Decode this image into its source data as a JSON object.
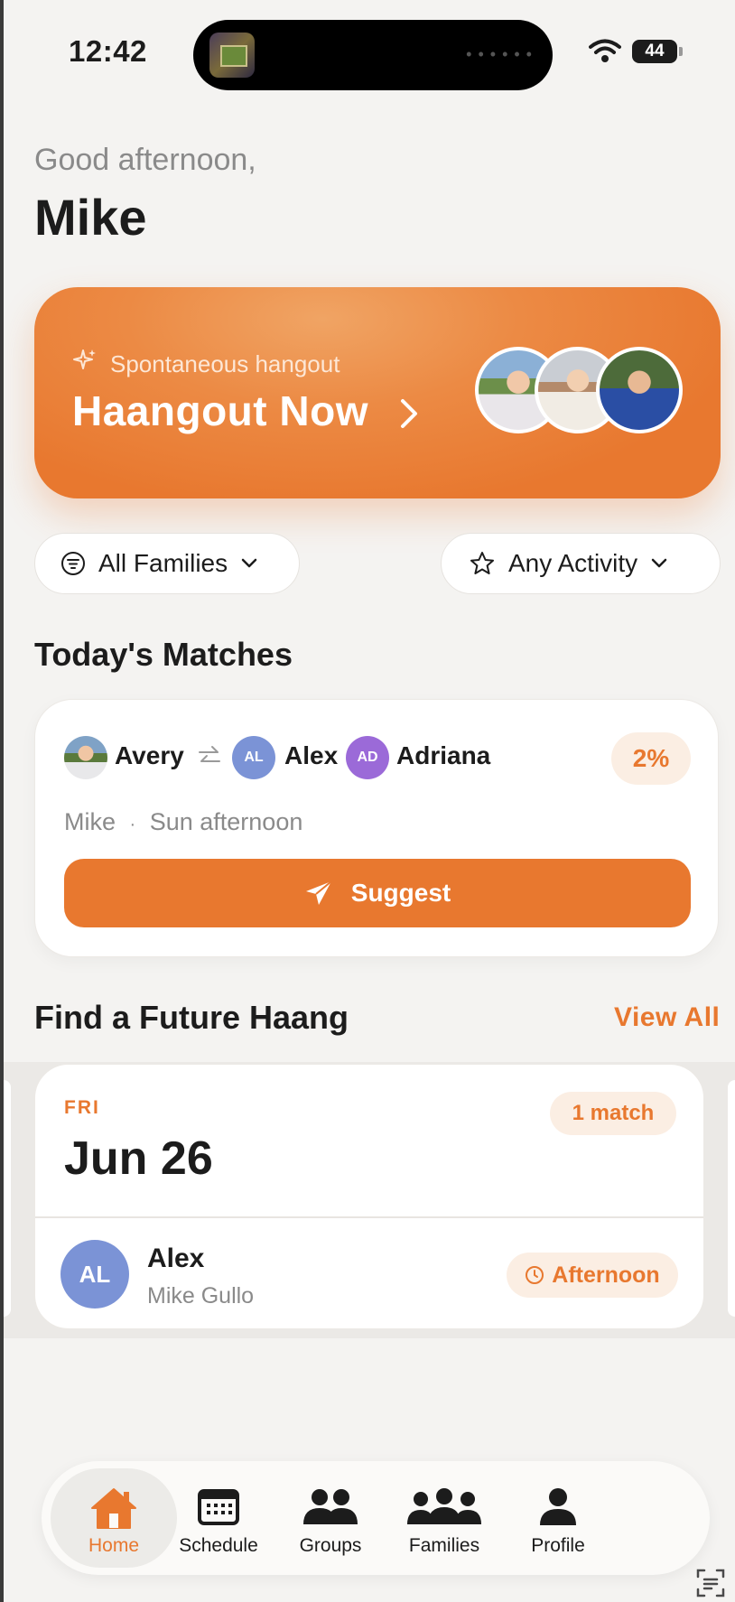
{
  "status_bar": {
    "time": "12:42",
    "battery": "44"
  },
  "greeting": {
    "line": "Good afternoon,",
    "name": "Mike"
  },
  "hero": {
    "subtitle": "Spontaneous hangout",
    "title": "Haangout Now",
    "accent": "#e8782f"
  },
  "filters": {
    "families": "All Families",
    "activity": "Any Activity"
  },
  "matches": {
    "title": "Today's Matches",
    "card": {
      "person1": "Avery",
      "person2_initials": "AL",
      "person2": "Alex",
      "person3_initials": "AD",
      "person3": "Adriana",
      "percent": "2%",
      "host": "Mike",
      "separator": "·",
      "time": "Sun afternoon",
      "action": "Suggest"
    }
  },
  "future": {
    "title": "Find a Future Haang",
    "view_all": "View All",
    "card": {
      "dow": "FRI",
      "date": "Jun 26",
      "badge": "1 match",
      "initials": "AL",
      "name": "Alex",
      "parent": "Mike Gullo",
      "time": "Afternoon"
    }
  },
  "tabs": [
    {
      "label": "Home",
      "icon": "home-icon",
      "active": true
    },
    {
      "label": "Schedule",
      "icon": "calendar-icon",
      "active": false
    },
    {
      "label": "Groups",
      "icon": "groups-icon",
      "active": false
    },
    {
      "label": "Families",
      "icon": "families-icon",
      "active": false
    },
    {
      "label": "Profile",
      "icon": "profile-icon",
      "active": false
    }
  ],
  "colors": {
    "accent": "#e8782f",
    "accent_soft": "#fbeee3",
    "avatar_blue": "#7b93d6",
    "avatar_purple": "#9b6ad8"
  }
}
